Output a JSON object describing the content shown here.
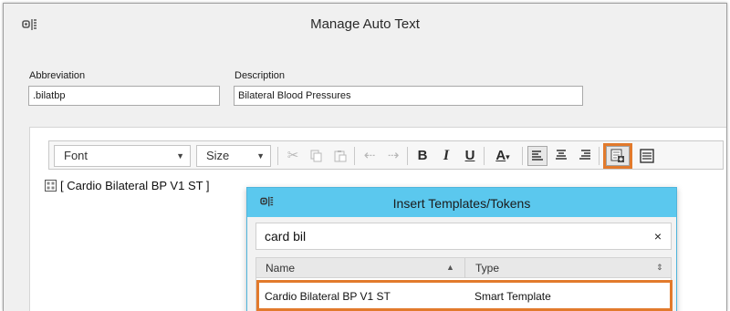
{
  "window": {
    "title": "Manage Auto Text"
  },
  "form": {
    "abbreviation_label": "Abbreviation",
    "abbreviation_value": ".bilatbp",
    "description_label": "Description",
    "description_value": "Bilateral Blood Pressures"
  },
  "toolbar": {
    "font_value": "Font",
    "size_value": "Size",
    "bold_label": "B",
    "italic_label": "I",
    "underline_label": "U",
    "font_color_label": "A",
    "icons": [
      "cut-icon",
      "copy-icon",
      "paste-icon",
      "undo-icon",
      "redo-icon",
      "bold-icon",
      "italic-icon",
      "underline-icon",
      "font-color-icon",
      "align-left-icon",
      "align-center-icon",
      "align-right-icon",
      "insert-template-icon",
      "template-list-icon"
    ]
  },
  "editor": {
    "content_text": "[ Cardio Bilateral BP V1 ST ]"
  },
  "dialog": {
    "title": "Insert Templates/Tokens",
    "search_value": "card bil",
    "clear_label": "×",
    "columns": [
      "Name",
      "Type"
    ],
    "rows": [
      {
        "name": "Cardio Bilateral BP V1 ST",
        "type": "Smart Template"
      }
    ]
  },
  "colors": {
    "highlight": "#e27a2c",
    "dialog_titlebar": "#5bc8ee",
    "window_bg": "#f0f0f0"
  }
}
